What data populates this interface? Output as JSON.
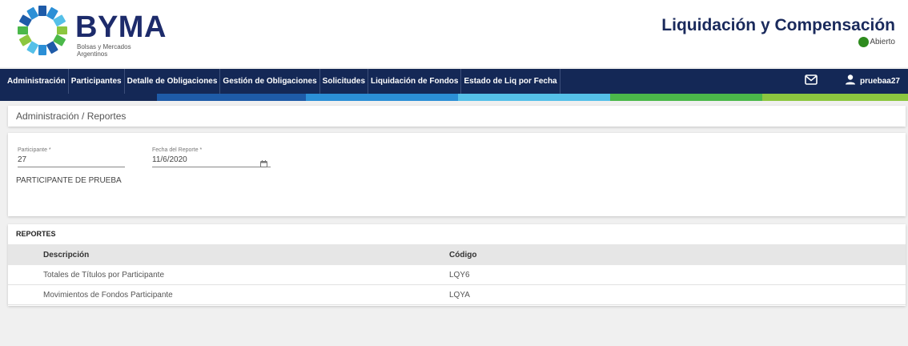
{
  "header": {
    "logo_name": "BYMA",
    "logo_sub_line1": "Bolsas y Mercados",
    "logo_sub_line2": "Argentinos",
    "app_title": "Liquidación y Compensación",
    "status_text": "Abierto",
    "status_color": "#2e8b1e"
  },
  "nav": {
    "items": [
      {
        "label": "Administración"
      },
      {
        "label": "Participantes"
      },
      {
        "label": "Detalle de Obligaciones"
      },
      {
        "label": "Gestión de Obligaciones"
      },
      {
        "label": "Solicitudes"
      },
      {
        "label": "Liquidación de Fondos"
      },
      {
        "label": "Estado de Liq por Fecha"
      }
    ],
    "mail_icon": "mail-icon",
    "user_icon": "user-icon",
    "username": "pruebaa27",
    "bg_color": "#142856",
    "stripe_colors": [
      "#142856",
      "#1e5ba8",
      "#2b8fd6",
      "#55c0e8",
      "#4bb84a",
      "#8cc63f"
    ]
  },
  "breadcrumb": "Administración / Reportes",
  "form": {
    "participante_label": "Participante *",
    "participante_value": "27",
    "fecha_label": "Fecha del Reporte *",
    "fecha_value": "11/6/2020",
    "calendar_icon": "calendar-icon",
    "participant_name": "PARTICIPANTE DE PRUEBA"
  },
  "reports": {
    "title": "REPORTES",
    "columns": [
      "Descripción",
      "Código"
    ],
    "rows": [
      {
        "descripcion": "Totales de Títulos por Participante",
        "codigo": "LQY6"
      },
      {
        "descripcion": "Movimientos de Fondos Participante",
        "codigo": "LQYA"
      }
    ]
  }
}
